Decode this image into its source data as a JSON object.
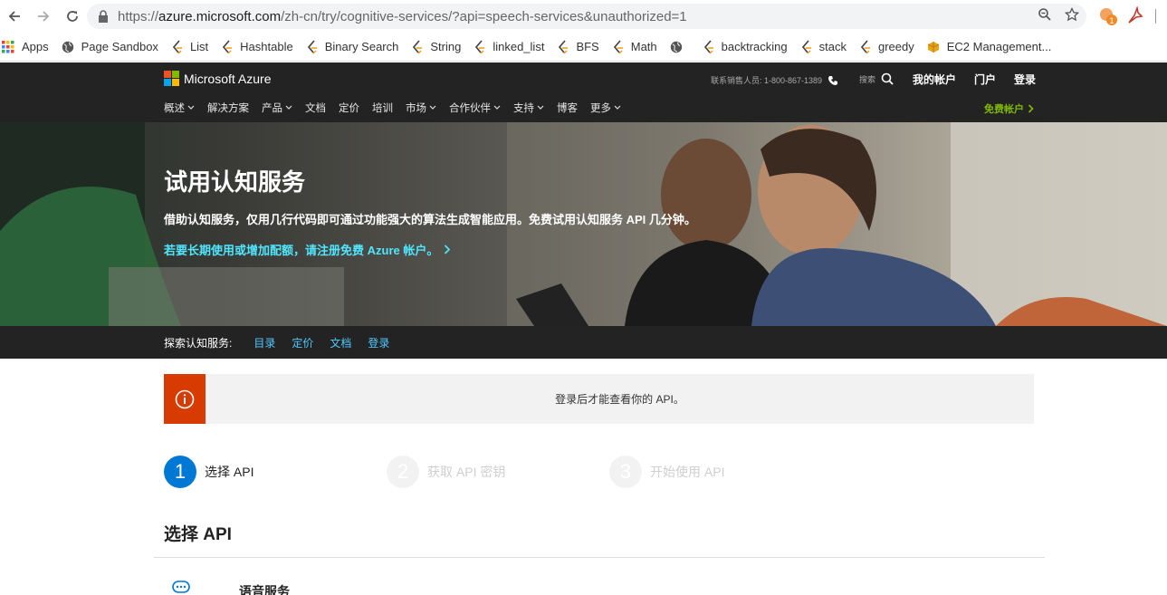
{
  "browser": {
    "url_prefix": "https://",
    "url_host": "azure.microsoft.com",
    "url_path": "/zh-cn/try/cognitive-services/?api=speech-services&unauthorized=1",
    "extension_badge": "1"
  },
  "bookmarks": [
    {
      "label": "Apps",
      "icon": "apps-grid-icon"
    },
    {
      "label": "Page Sandbox",
      "icon": "globe-icon"
    },
    {
      "label": "List",
      "icon": "leetcode-icon"
    },
    {
      "label": "Hashtable",
      "icon": "leetcode-icon"
    },
    {
      "label": "Binary Search",
      "icon": "leetcode-icon"
    },
    {
      "label": "String",
      "icon": "leetcode-icon"
    },
    {
      "label": "linked_list",
      "icon": "leetcode-icon"
    },
    {
      "label": "BFS",
      "icon": "leetcode-icon"
    },
    {
      "label": "Math",
      "icon": "leetcode-icon"
    },
    {
      "label": "",
      "icon": "globe-icon"
    },
    {
      "label": "backtracking",
      "icon": "leetcode-icon"
    },
    {
      "label": "stack",
      "icon": "leetcode-icon"
    },
    {
      "label": "greedy",
      "icon": "leetcode-icon"
    },
    {
      "label": "EC2 Management...",
      "icon": "aws-icon"
    }
  ],
  "azure": {
    "logo": "Microsoft Azure",
    "contact": "联系销售人员: 1-800-867-1389",
    "search": "搜索",
    "top_links": [
      "我的帐户",
      "门户",
      "登录"
    ],
    "menu": [
      {
        "label": "概述",
        "dropdown": true
      },
      {
        "label": "解决方案",
        "dropdown": false
      },
      {
        "label": "产品",
        "dropdown": true
      },
      {
        "label": "文档",
        "dropdown": false
      },
      {
        "label": "定价",
        "dropdown": false
      },
      {
        "label": "培训",
        "dropdown": false
      },
      {
        "label": "市场",
        "dropdown": true
      },
      {
        "label": "合作伙伴",
        "dropdown": true
      },
      {
        "label": "支持",
        "dropdown": true
      },
      {
        "label": "博客",
        "dropdown": false
      },
      {
        "label": "更多",
        "dropdown": true
      }
    ],
    "free_account": "免费帐户"
  },
  "hero": {
    "title": "试用认知服务",
    "subtitle": "借助认知服务，仅用几行代码即可通过功能强大的算法生成智能应用。免费试用认知服务 API 几分钟。",
    "link": "若要长期使用或增加配额，请注册免费 Azure 帐户。"
  },
  "explore": {
    "label": "探索认知服务:",
    "links": [
      "目录",
      "定价",
      "文档",
      "登录"
    ]
  },
  "info": {
    "text": "登录后才能查看你的 API。"
  },
  "steps": [
    {
      "num": "1",
      "label": "选择 API",
      "active": true
    },
    {
      "num": "2",
      "label": "获取 API 密钥",
      "active": false
    },
    {
      "num": "3",
      "label": "开始使用 API",
      "active": false
    }
  ],
  "section": {
    "title": "选择 API"
  },
  "api_items": [
    {
      "label": "语音服务",
      "icon": "speech-chat-icon"
    }
  ],
  "colors": {
    "azure_blue": "#0078d4",
    "header_bg": "#232323",
    "alert_orange": "#d83b01",
    "free_green": "#7fba00",
    "link_cyan": "#50e6ff"
  }
}
